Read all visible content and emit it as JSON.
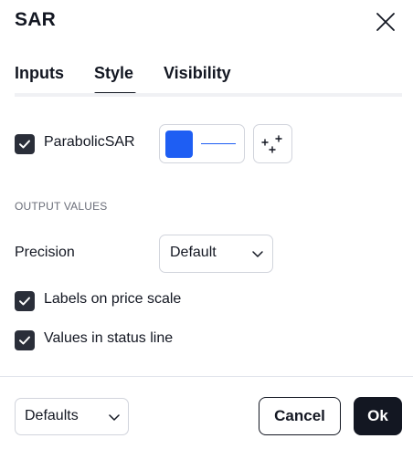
{
  "dialog": {
    "title": "SAR"
  },
  "tabs": [
    {
      "label": "Inputs",
      "active": false
    },
    {
      "label": "Style",
      "active": true
    },
    {
      "label": "Visibility",
      "active": false
    }
  ],
  "style": {
    "plot": {
      "label": "ParabolicSAR",
      "checked": true,
      "color": "#1e5ef3"
    },
    "output_values_header": "OUTPUT VALUES",
    "precision": {
      "label": "Precision",
      "value": "Default"
    },
    "labels_on_price_scale": {
      "label": "Labels on price scale",
      "checked": true
    },
    "values_in_status_line": {
      "label": "Values in status line",
      "checked": true
    }
  },
  "footer": {
    "defaults_label": "Defaults",
    "cancel_label": "Cancel",
    "ok_label": "Ok"
  },
  "icons": [
    "close-icon",
    "check-icon",
    "plot-style-icon",
    "chevron-down-icon"
  ],
  "colors": {
    "accent": "#1e5ef3",
    "primary_dark": "#131722",
    "border": "#d1d4dc",
    "muted_text": "#6a6d78"
  }
}
